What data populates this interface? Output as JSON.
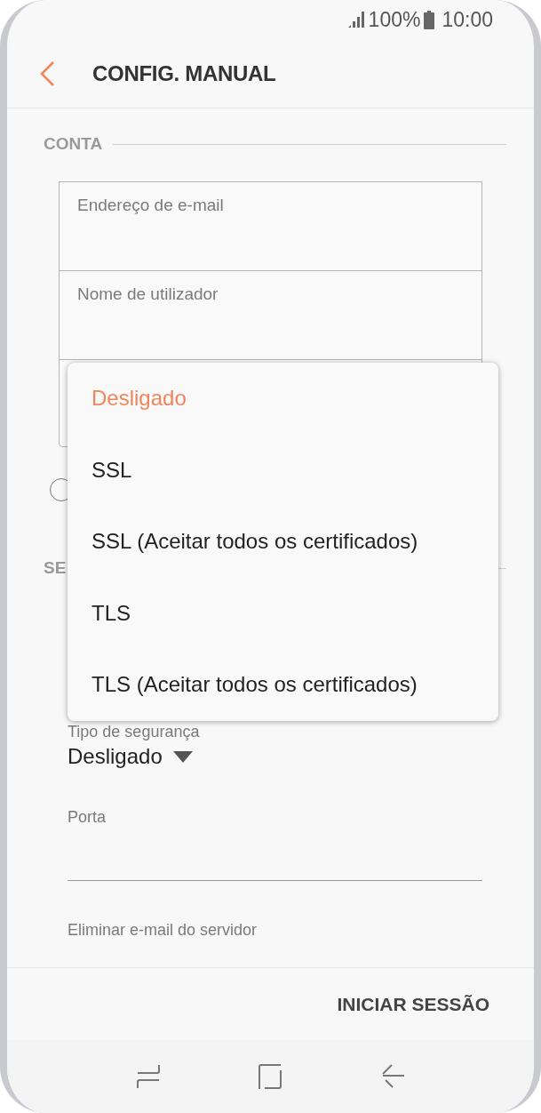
{
  "status_bar": {
    "battery": "100%",
    "time": "10:00"
  },
  "header": {
    "title": "CONFIG. MANUAL"
  },
  "account": {
    "title": "CONTA",
    "fields": [
      {
        "placeholder": "Endereço de e-mail"
      },
      {
        "placeholder": "Nome de utilizador"
      }
    ],
    "remember": {
      "checked": false
    }
  },
  "server": {
    "title": "SE",
    "fields": [
      {
        "kind": "dropdown",
        "label": "Tipo de segurança",
        "value": "Desligado"
      },
      {
        "kind": "input",
        "label": "Porta"
      },
      {
        "kind": "label",
        "label": "Eliminar e-mail do servidor"
      }
    ]
  },
  "menu": {
    "items": [
      {
        "label": "Desligado",
        "selected": true
      },
      {
        "label": "SSL",
        "selected": false
      },
      {
        "label": "SSL (Aceitar todos os certificados)",
        "selected": false
      },
      {
        "label": "TLS",
        "selected": false
      },
      {
        "label": "TLS (Aceitar todos os certificados)",
        "selected": false
      }
    ]
  },
  "footer": {
    "button": "INICIAR SESSÃO"
  }
}
